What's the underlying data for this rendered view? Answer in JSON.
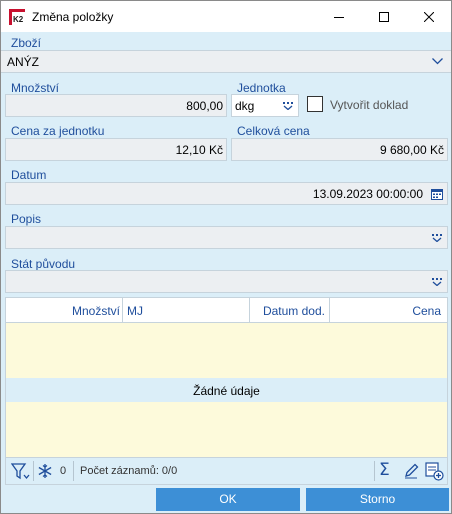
{
  "window": {
    "title": "Změna položky",
    "app_icon": "kelt-app-icon",
    "minimize_icon": "minimize-icon",
    "maximize_icon": "maximize-icon",
    "close_icon": "close-icon"
  },
  "form": {
    "goods": {
      "label": "Zboží",
      "value": "ANÝZ"
    },
    "quantity": {
      "label": "Množství",
      "value": "800,00"
    },
    "unit": {
      "label": "Jednotka",
      "value": "dkg"
    },
    "create_document": {
      "label": "Vytvořit doklad",
      "checked": false
    },
    "unit_price": {
      "label": "Cena za jednotku",
      "value": "12,10 Kč"
    },
    "total_price": {
      "label": "Celková cena",
      "value": "9 680,00 Kč"
    },
    "date": {
      "label": "Datum",
      "value": "13.09.2023 00:00:00"
    },
    "description": {
      "label": "Popis",
      "value": ""
    },
    "origin_country": {
      "label": "Stát původu",
      "value": ""
    }
  },
  "grid": {
    "columns": [
      "Množství",
      "MJ",
      "Datum dod.",
      "Cena"
    ],
    "empty_text": "Žádné údaje",
    "rows": []
  },
  "statusbar": {
    "filter_count": "0",
    "record_count": "Počet záznamů: 0/0"
  },
  "buttons": {
    "ok": "OK",
    "cancel": "Storno"
  },
  "colors": {
    "background": "#dbeef8",
    "accent_button": "#3d8fd6",
    "label": "#1f4e9c",
    "grid_background": "#fdfadb"
  }
}
